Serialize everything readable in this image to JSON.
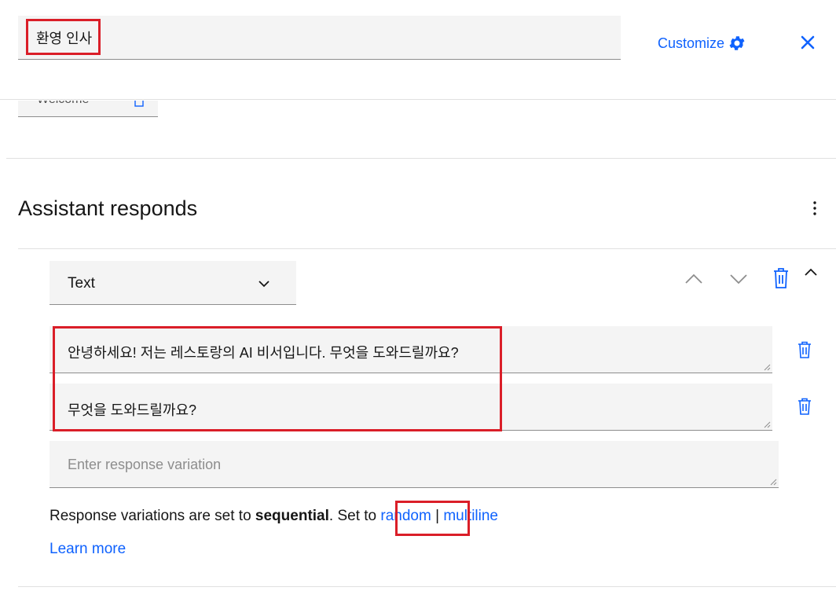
{
  "header": {
    "name_value": "환영 인사",
    "customize_label": "Customize",
    "close_icon": "close-icon",
    "gear_icon": "gear-icon"
  },
  "collapsed_field": {
    "value": "Welcome"
  },
  "assistant": {
    "title": "Assistant responds",
    "response_type": "Text",
    "variations": [
      "안녕하세요! 저는 레스토랑의 AI 비서입니다. 무엇을 도와드릴까요?",
      "무엇을 도와드릴까요?"
    ],
    "new_variation_placeholder": "Enter response variation",
    "note_prefix": "Response variations are set to ",
    "note_mode": "sequential",
    "note_mid": ". Set to ",
    "link_random": "random",
    "separator": "|",
    "link_multiline": "multiline",
    "learn_more": "Learn more"
  },
  "colors": {
    "accent": "#0f62fe",
    "highlight": "#da1e28",
    "field_bg": "#f4f4f4"
  }
}
